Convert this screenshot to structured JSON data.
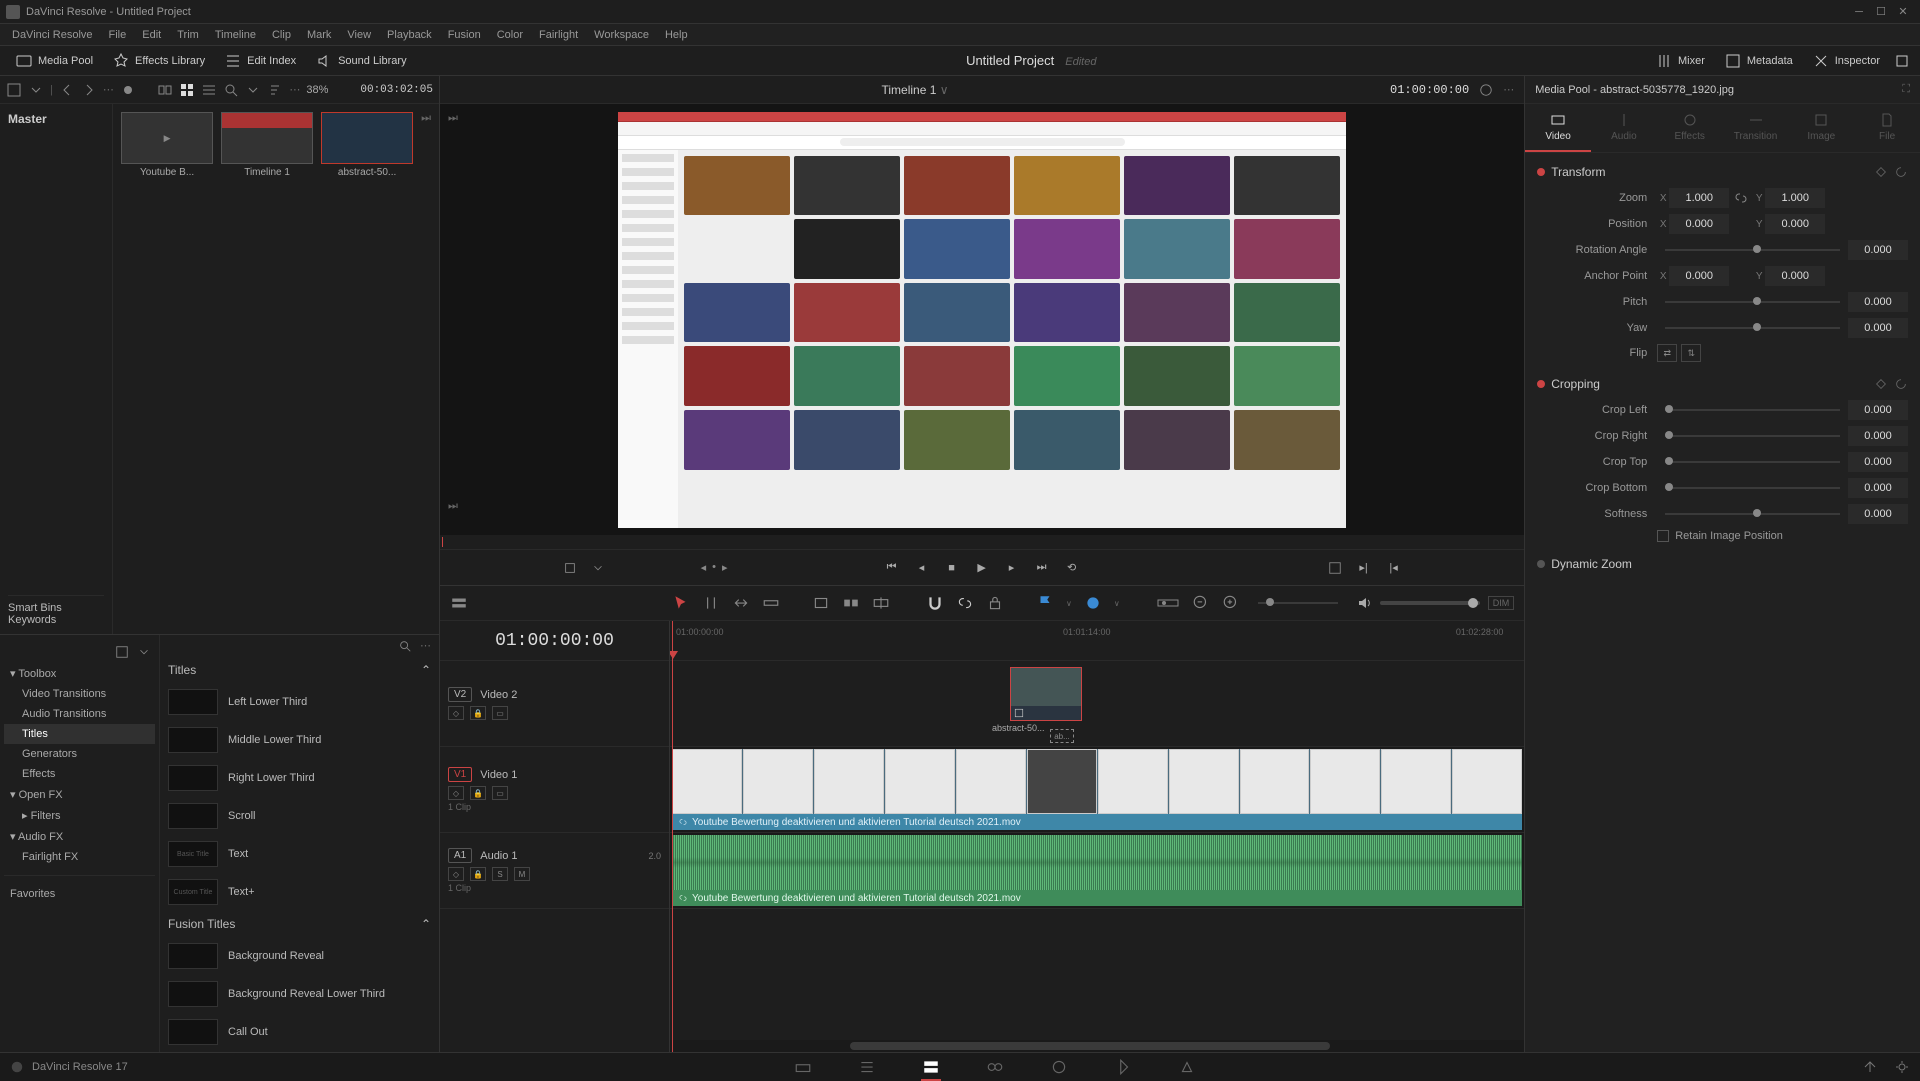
{
  "titlebar": {
    "title": "DaVinci Resolve - Untitled Project"
  },
  "menu": [
    "DaVinci Resolve",
    "File",
    "Edit",
    "Trim",
    "Timeline",
    "Clip",
    "Mark",
    "View",
    "Playback",
    "Fusion",
    "Color",
    "Fairlight",
    "Workspace",
    "Help"
  ],
  "topbar": {
    "media_pool": "Media Pool",
    "fx_lib": "Effects Library",
    "edit_index": "Edit Index",
    "sound_lib": "Sound Library",
    "project_title": "Untitled Project",
    "edited": "Edited",
    "mixer": "Mixer",
    "metadata": "Metadata",
    "inspector": "Inspector"
  },
  "viewer_bar": {
    "fit_pct": "38%",
    "left_tc": "00:03:02:05",
    "timeline_name": "Timeline 1",
    "right_tc": "01:00:00:00"
  },
  "media_pool": {
    "master": "Master",
    "smart_bins": "Smart Bins",
    "keywords": "Keywords",
    "items": [
      {
        "label": "Youtube B..."
      },
      {
        "label": "Timeline 1"
      },
      {
        "label": "abstract-50..."
      }
    ]
  },
  "fx": {
    "tree": {
      "toolbox": "Toolbox",
      "video_trans": "Video Transitions",
      "audio_trans": "Audio Transitions",
      "titles": "Titles",
      "generators": "Generators",
      "effects": "Effects",
      "openfx": "Open FX",
      "filters": "Filters",
      "audiofx": "Audio FX",
      "fairlight": "Fairlight FX",
      "favorites": "Favorites"
    },
    "section_titles": "Titles",
    "section_fusion": "Fusion Titles",
    "list": [
      "Left Lower Third",
      "Middle Lower Third",
      "Right Lower Third",
      "Scroll",
      "Text",
      "Text+"
    ],
    "fusion_list": [
      "Background Reveal",
      "Background Reveal Lower Third",
      "Call Out"
    ]
  },
  "transport": {},
  "tl_toolbar": {
    "dim": "DIM"
  },
  "timeline": {
    "master_tc": "01:00:00:00",
    "ruler": [
      "01:00:00:00",
      "01:01:14:00",
      "01:02:28:00"
    ],
    "v2": {
      "badge": "V2",
      "name": "Video 2",
      "clip_label": "abstract-50...",
      "ghost": "ab..."
    },
    "v1": {
      "badge": "V1",
      "name": "Video 1",
      "meta": "1 Clip",
      "clip_label": "Youtube Bewertung deaktivieren und aktivieren Tutorial deutsch 2021.mov"
    },
    "a1": {
      "badge": "A1",
      "name": "Audio 1",
      "ch": "2.0",
      "meta": "1 Clip",
      "s": "S",
      "m": "M",
      "clip_label": "Youtube Bewertung deaktivieren und aktivieren Tutorial deutsch 2021.mov"
    }
  },
  "inspector": {
    "title": "Media Pool - abstract-5035778_1920.jpg",
    "tabs": [
      "Video",
      "Audio",
      "Effects",
      "Transition",
      "Image",
      "File"
    ],
    "transform": {
      "head": "Transform",
      "zoom": "Zoom",
      "zoom_x": "1.000",
      "zoom_y": "1.000",
      "position": "Position",
      "pos_x": "0.000",
      "pos_y": "0.000",
      "rotation": "Rotation Angle",
      "rot_v": "0.000",
      "anchor": "Anchor Point",
      "anc_x": "0.000",
      "anc_y": "0.000",
      "pitch": "Pitch",
      "pitch_v": "0.000",
      "yaw": "Yaw",
      "yaw_v": "0.000",
      "flip": "Flip"
    },
    "cropping": {
      "head": "Cropping",
      "left": "Crop Left",
      "left_v": "0.000",
      "right": "Crop Right",
      "right_v": "0.000",
      "top": "Crop Top",
      "top_v": "0.000",
      "bottom": "Crop Bottom",
      "bottom_v": "0.000",
      "soft": "Softness",
      "soft_v": "0.000",
      "retain": "Retain Image Position"
    },
    "dyn": "Dynamic Zoom"
  },
  "pagebar": {
    "version": "DaVinci Resolve 17"
  }
}
